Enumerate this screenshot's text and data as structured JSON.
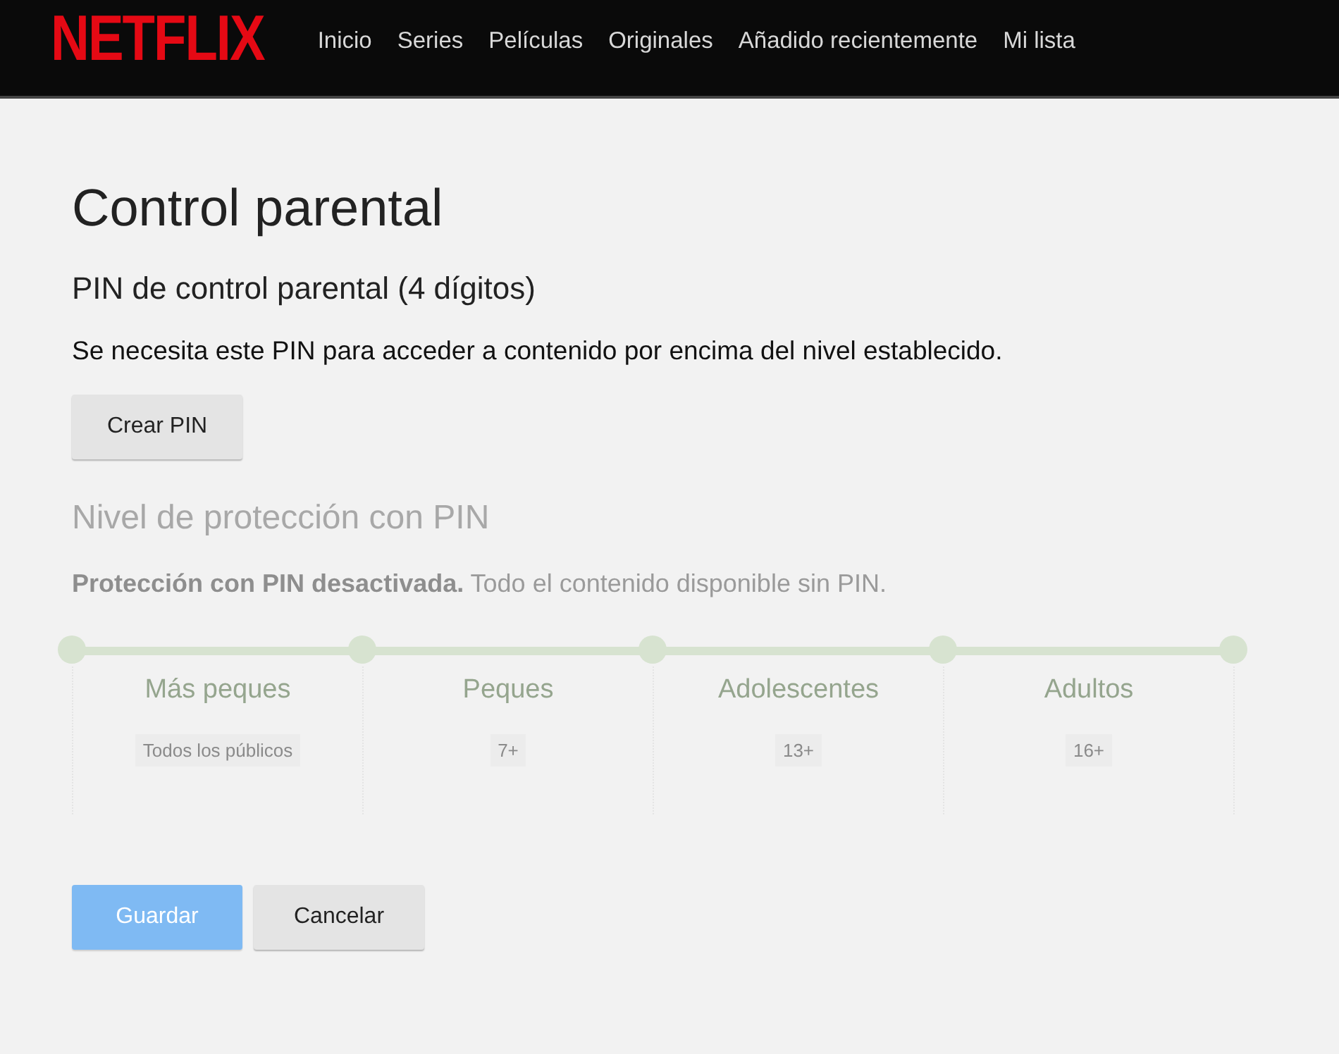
{
  "header": {
    "logo": "NETFLIX",
    "nav": [
      {
        "label": "Inicio"
      },
      {
        "label": "Series"
      },
      {
        "label": "Películas"
      },
      {
        "label": "Originales"
      },
      {
        "label": "Añadido recientemente"
      },
      {
        "label": "Mi lista"
      }
    ]
  },
  "title": "Control parental",
  "pin": {
    "heading": "PIN de control parental (4 dígitos)",
    "description": "Se necesita este PIN para acceder a contenido por encima del nivel establecido.",
    "button": "Crear PIN"
  },
  "protection": {
    "disabled": true,
    "heading": "Nivel de protección con PIN",
    "status": "**Protección con PIN desactivada.** Todo el contenido disponible sin PIN.",
    "levels": [
      {
        "label": "Más peques",
        "rating": "Todos los públicos"
      },
      {
        "label": "Peques",
        "rating": "7+"
      },
      {
        "label": "Adolescentes",
        "rating": "13+"
      },
      {
        "label": "Adultos",
        "rating": "16+"
      }
    ]
  },
  "actions": [
    {
      "label": "Guardar",
      "kind": "primary"
    },
    {
      "label": "Cancelar",
      "kind": "secondary"
    }
  ]
}
